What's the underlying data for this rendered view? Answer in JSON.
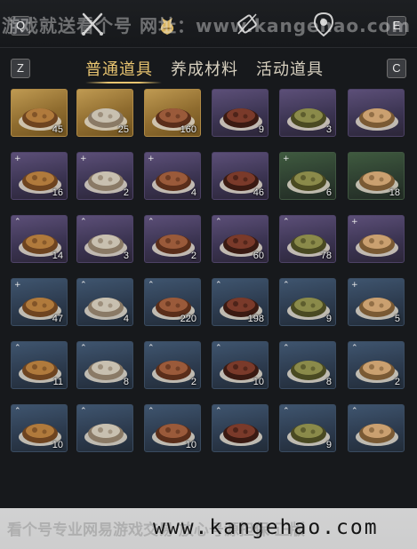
{
  "topbar": {
    "left_key": "Q",
    "right_key": "E",
    "icons": [
      "crossed-swords-icon",
      "money-pouch-icon",
      "scroll-brush-icon",
      "map-marker-icon"
    ]
  },
  "tabs": {
    "left_key": "Z",
    "right_key": "C",
    "items": [
      {
        "label": "普通道具",
        "active": true
      },
      {
        "label": "养成材料",
        "active": false
      },
      {
        "label": "活动道具",
        "active": false
      }
    ]
  },
  "items": [
    {
      "icon": "bronze-ring-icon",
      "count": "45",
      "quality": "gold"
    },
    {
      "icon": "gold-ingot-icon",
      "count": "25",
      "quality": "gold"
    },
    {
      "icon": "copper-coin-icon",
      "count": "160",
      "quality": "gold"
    },
    {
      "icon": "jade-ore-icon",
      "count": "9",
      "quality": "purple"
    },
    {
      "icon": "braised-dish-icon",
      "count": "3",
      "quality": "purple"
    },
    {
      "icon": "meat-bowl-icon",
      "count": "",
      "quality": "purple"
    },
    {
      "icon": "stew-pot-icon",
      "count": "16",
      "quality": "purple",
      "badge": "+"
    },
    {
      "icon": "steamed-buns-icon",
      "count": "2",
      "quality": "purple",
      "badge": "+"
    },
    {
      "icon": "meat-stew-bowl-icon",
      "count": "4",
      "quality": "purple",
      "badge": "+"
    },
    {
      "icon": "wine-jar-icon",
      "count": "46",
      "quality": "purple"
    },
    {
      "icon": "stir-fry-icon",
      "count": "6",
      "quality": "green",
      "badge": "+"
    },
    {
      "icon": "fish-platter-icon",
      "count": "18",
      "quality": "green"
    },
    {
      "icon": "chestnuts-icon",
      "count": "14",
      "quality": "purple",
      "badge": "^"
    },
    {
      "icon": "red-braised-pork-icon",
      "count": "3",
      "quality": "purple",
      "badge": "^"
    },
    {
      "icon": "noodle-bowl-icon",
      "count": "2",
      "quality": "purple",
      "badge": "^"
    },
    {
      "icon": "pork-belly-icon",
      "count": "60",
      "quality": "purple",
      "badge": "^"
    },
    {
      "icon": "meatballs-icon",
      "count": "78",
      "quality": "purple",
      "badge": "^"
    },
    {
      "icon": "lotus-root-icon",
      "count": "",
      "quality": "purple",
      "badge": "+"
    },
    {
      "icon": "lotus-slices-icon",
      "count": "47",
      "quality": "blue",
      "badge": "+"
    },
    {
      "icon": "spring-rolls-icon",
      "count": "4",
      "quality": "blue",
      "badge": "^"
    },
    {
      "icon": "clay-pot-icon",
      "count": "220",
      "quality": "blue",
      "badge": "^"
    },
    {
      "icon": "fried-cakes-icon",
      "count": "198",
      "quality": "blue",
      "badge": "^"
    },
    {
      "icon": "sliced-meat-icon",
      "count": "9",
      "quality": "blue",
      "badge": "^"
    },
    {
      "icon": "egg-soup-icon",
      "count": "5",
      "quality": "blue",
      "badge": "+"
    },
    {
      "icon": "fish-slices-icon",
      "count": "11",
      "quality": "blue",
      "badge": "^"
    },
    {
      "icon": "meat-pie-icon",
      "count": "8",
      "quality": "blue",
      "badge": "^"
    },
    {
      "icon": "shredded-dish-icon",
      "count": "2",
      "quality": "blue",
      "badge": "^"
    },
    {
      "icon": "rice-cake-icon",
      "count": "10",
      "quality": "blue",
      "badge": "^"
    },
    {
      "icon": "soup-bowl-icon",
      "count": "8",
      "quality": "blue",
      "badge": "^"
    },
    {
      "icon": "chili-stew-icon",
      "count": "2",
      "quality": "blue",
      "badge": "^"
    },
    {
      "icon": "oyster-plate-icon",
      "count": "10",
      "quality": "blue",
      "badge": "^"
    },
    {
      "icon": "fish-plate-icon",
      "count": "",
      "quality": "blue",
      "badge": "^"
    },
    {
      "icon": "greens-bowl-icon",
      "count": "10",
      "quality": "blue",
      "badge": "^"
    },
    {
      "icon": "leaf-soup-icon",
      "count": "",
      "quality": "blue",
      "badge": "^"
    },
    {
      "icon": "herb-plate-icon",
      "count": "9",
      "quality": "blue",
      "badge": "^"
    },
    {
      "icon": "tomato-soup-icon",
      "count": "",
      "quality": "blue",
      "badge": "^"
    }
  ],
  "watermark": {
    "top_text": "游戏就送看个号 网址：www.kangehao.com",
    "bottom_faded": "看个号专业网易游戏交易 放心号源担保 正版",
    "bottom_url": "www.kangehao.com"
  },
  "colors": {
    "accent": "#e8c470",
    "gold": "#a8813c",
    "purple": "#4a3f62",
    "blue": "#34465c",
    "green": "#354a37"
  }
}
